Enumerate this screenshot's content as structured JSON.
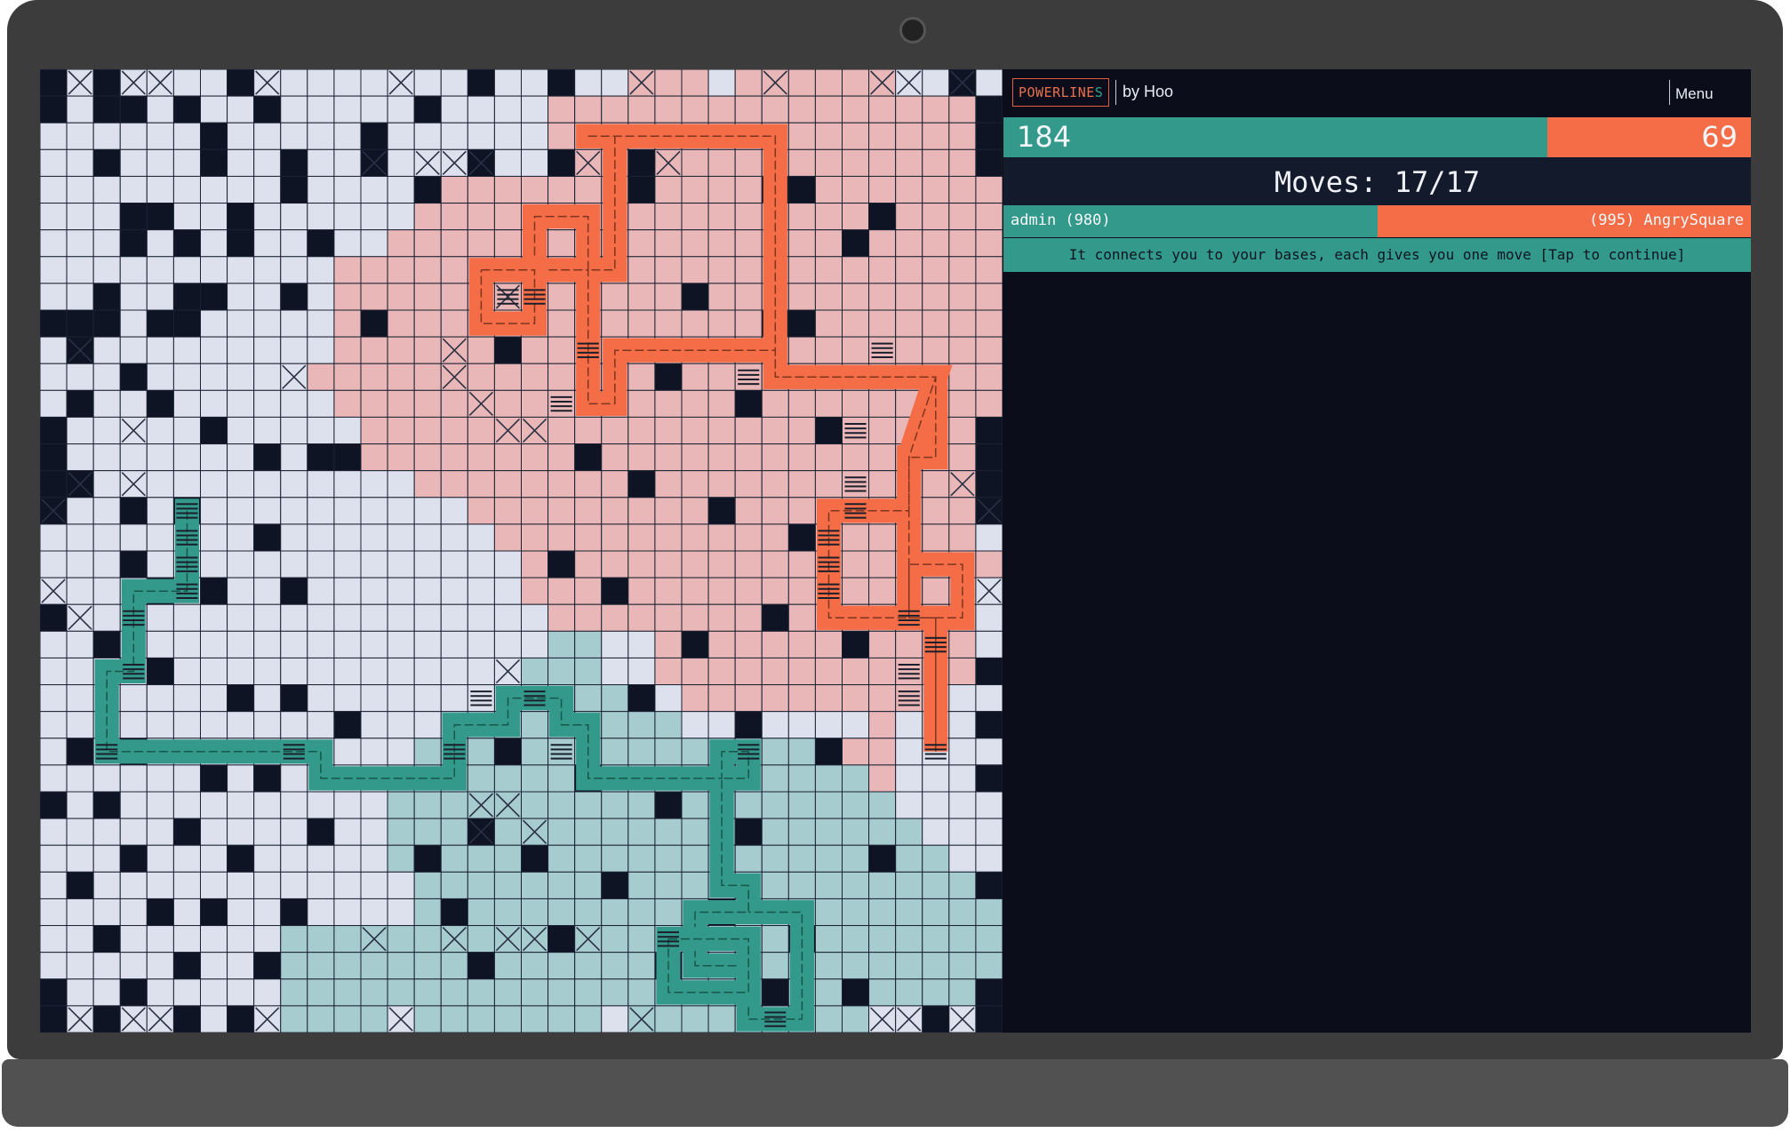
{
  "app": {
    "logo_part1": "POWERLINE",
    "logo_part2": "S",
    "byline": "by Hoo",
    "menu_label": "Menu"
  },
  "score": {
    "green": 184,
    "orange": 69,
    "green_label": "184",
    "orange_label": "69"
  },
  "moves": {
    "text": "Moves: 17/17"
  },
  "players": {
    "left": "admin (980)",
    "right": "(995) AngrySquare",
    "left_share": 0.5
  },
  "message": "It connects you to your bases, each gives you one move [Tap to continue]",
  "colors": {
    "green_team": "#33998a",
    "orange_team": "#f46d46",
    "background": "#0b0e1a",
    "neutral_cell": "#dde1ee",
    "blocked_cell": "#0e1424",
    "orange_territory": "#e9b7b7",
    "green_territory": "#a6ccd0"
  },
  "board": {
    "cols": 36,
    "rows": 36,
    "legend": {
      "N": "neutral cell",
      "B": "blocked cell",
      "O": "orange territory",
      "G": "green territory",
      "o": "orange powerline",
      "g": "green powerline",
      "X": "crossed marker"
    },
    "grid": [
      "BXBXXNNBNXNNNXNNBNNBNXOOOXOOOOOOXXBX",
      "BNBNNBNNNNNNNNBNNNNOOOOOOOOOOOOOOOOB",
      "NNNNNNNNNNNNNNNNNNNOOOOOOOOOOOOOOOOB",
      "NNBNNNBNNBNNBXNXBXXBOOBOOOOOOOOOOOOB",
      "NNNNNNNNNBNNNNBOOOOOOOOOOOOOBOOOOOOO",
      "NNNNBNNNNNNNNNOOOOOOOOOOOOOOOOOBOOOO",
      "NNNBNBNBNNNNNOOOOOOOOOOOOOOOOOOOOOOO",
      "NNNNNNNNNNNOOOOOOOOOOOOOOOOOOOOOOOOO",
      "NNNNNNNNNNNOOOOOOOOOOOOOOOOOOOOOOOOO",
      "BBBNBBNNNNNOOOOOOOOOOOOOOOOBOOOOOOOO",
      "NBNNNNNNNNNOOOOOOOOOOOOOOOOOOOOOOOOO",
      "NXNNNNNNNNOOOOOOOOOOOOOOOOOOOOOOOOOO",
      "NNNNBNNNNNNOOOOOOOOOOOOOOOOOOOOOOOOO",
      "BNNNNNNNNNNNOOOOOOOOOOOOOOOOOOOOOOOB",
      "BNNNNNNNNNNOOOOOOOOOOOOOOOOOOOOOOOOB",
      "BNNNNNNNNNNNNNOOOOOOOOOOOOOOOOOOOOOB",
      "BNNNNNNNNNNNNNNNOOOOOOOOOOOOOOOOOOOB",
      "XNNNNNNNNNNNNNNNNOOOOOOOOOOOOOOOOOOX",
      "NNNNNNNNNNNNNNNNNNOOOOOOOOOOOOOOOOOO",
      "NNNNNNNNNNNNNNNNNNOOOOOOOOOOOOOOOOON",
      "NNNNNNNNNNNNNNNNNNNOOOOOOOOOOOOOOOON",
      "XNNNNNNNNNNNNNNNNNNGGNNOOOOOOOOOOOOX",
      "NNNNNNNNNNNNNNNNNNGGGNNOOOOOOOOOOOOB",
      "NNNNNNNNNNNNNNNNNGGGGGNNOOOOOOOOONNN",
      "NNNNNNNNNNNNNNNGGGGGGGGGNNNNNNNONNNB",
      "NNNNNNNNNNNNNNGGGGGGGGGGGGGGGGOONNNN",
      "NNNNNNNNNNNNNGGGGGGGGGGGGGGGGGGONNNB",
      "NNNNNNNNNNNNNGGGGGGGGGGGGGGGGGGGNNNN",
      "NNNNNNNNNNNNNGGGGGGGGGGGGGGGGGGGGNNN",
      "NNNNNNNNNNNNNGGGGGGGGGGGGGGGGGGGGGNN",
      "NNNNNNNNNNNNNNGGGGGGGGGGGGGGGGGGGGGB",
      "NNNNNNNNNNNNNNGGGGGGGGGGGGGGGGGGGGGG",
      "NNNNNNNNNGGGGGGGGGGGGGGGGGGGGGGGGGGG",
      "NNNNNNNNGGGGGGGGGGGGGGGGGGGGGGGGGGGG",
      "NNNNNNNNNGGGGGGGGGGGGGGGGGGGGGGGGGGB",
      "BXBXXBNBXGGGGXGGGGGGGXGGGGGGGGGXXBXB"
    ],
    "blocked_extra": [
      [
        3,
        1
      ],
      [
        6,
        2
      ],
      [
        8,
        1
      ],
      [
        12,
        2
      ],
      [
        3,
        5
      ],
      [
        7,
        5
      ],
      [
        10,
        6
      ],
      [
        2,
        8
      ],
      [
        5,
        8
      ],
      [
        6,
        8
      ],
      [
        9,
        8
      ],
      [
        12,
        9
      ],
      [
        3,
        11
      ],
      [
        1,
        12
      ],
      [
        4,
        12
      ],
      [
        6,
        13
      ],
      [
        8,
        14
      ],
      [
        10,
        14
      ],
      [
        11,
        14
      ],
      [
        1,
        15
      ],
      [
        3,
        16
      ],
      [
        5,
        16
      ],
      [
        8,
        17
      ],
      [
        3,
        18
      ],
      [
        4,
        19
      ],
      [
        6,
        19
      ],
      [
        9,
        19
      ],
      [
        0,
        20
      ],
      [
        2,
        21
      ],
      [
        4,
        22
      ],
      [
        7,
        23
      ],
      [
        9,
        23
      ],
      [
        11,
        24
      ],
      [
        1,
        25
      ],
      [
        3,
        25
      ],
      [
        6,
        26
      ],
      [
        8,
        26
      ],
      [
        0,
        27
      ],
      [
        2,
        27
      ],
      [
        5,
        28
      ],
      [
        10,
        28
      ],
      [
        3,
        29
      ],
      [
        7,
        29
      ],
      [
        1,
        30
      ],
      [
        4,
        31
      ],
      [
        6,
        31
      ],
      [
        9,
        31
      ],
      [
        2,
        32
      ],
      [
        5,
        33
      ],
      [
        8,
        33
      ],
      [
        0,
        34
      ],
      [
        3,
        34
      ],
      [
        22,
        4
      ],
      [
        27,
        4
      ],
      [
        30,
        6
      ],
      [
        24,
        8
      ],
      [
        28,
        9
      ],
      [
        17,
        10
      ],
      [
        23,
        11
      ],
      [
        26,
        12
      ],
      [
        29,
        13
      ],
      [
        20,
        14
      ],
      [
        22,
        15
      ],
      [
        25,
        16
      ],
      [
        28,
        17
      ],
      [
        19,
        18
      ],
      [
        21,
        19
      ],
      [
        27,
        20
      ],
      [
        30,
        21
      ],
      [
        24,
        21
      ],
      [
        22,
        23
      ],
      [
        26,
        24
      ],
      [
        17,
        25
      ],
      [
        29,
        25
      ],
      [
        20,
        26
      ],
      [
        23,
        27
      ],
      [
        26,
        28
      ],
      [
        18,
        29
      ],
      [
        31,
        29
      ],
      [
        21,
        30
      ],
      [
        25,
        31
      ],
      [
        28,
        32
      ],
      [
        19,
        32
      ],
      [
        23,
        33
      ],
      [
        16,
        33
      ],
      [
        27,
        34
      ],
      [
        30,
        34
      ],
      [
        14,
        29
      ],
      [
        16,
        28
      ],
      [
        15,
        31
      ]
    ],
    "crosses": [
      [
        1,
        0
      ],
      [
        3,
        0
      ],
      [
        4,
        0
      ],
      [
        8,
        0
      ],
      [
        13,
        0
      ],
      [
        22,
        0
      ],
      [
        27,
        0
      ],
      [
        31,
        0
      ],
      [
        32,
        0
      ],
      [
        34,
        0
      ],
      [
        12,
        3
      ],
      [
        14,
        3
      ],
      [
        15,
        3
      ],
      [
        16,
        3
      ],
      [
        20,
        3
      ],
      [
        23,
        3
      ],
      [
        16,
        7
      ],
      [
        19,
        7
      ],
      [
        17,
        8
      ],
      [
        1,
        10
      ],
      [
        15,
        10
      ],
      [
        15,
        11
      ],
      [
        9,
        11
      ],
      [
        16,
        12
      ],
      [
        17,
        13
      ],
      [
        18,
        13
      ],
      [
        3,
        13
      ],
      [
        1,
        15
      ],
      [
        3,
        15
      ],
      [
        0,
        16
      ],
      [
        34,
        15
      ],
      [
        35,
        16
      ],
      [
        0,
        19
      ],
      [
        35,
        19
      ],
      [
        1,
        20
      ],
      [
        17,
        22
      ],
      [
        19,
        23
      ],
      [
        16,
        27
      ],
      [
        17,
        27
      ],
      [
        18,
        28
      ],
      [
        16,
        28
      ],
      [
        12,
        32
      ],
      [
        15,
        32
      ],
      [
        17,
        32
      ],
      [
        18,
        32
      ],
      [
        20,
        32
      ],
      [
        1,
        35
      ],
      [
        3,
        35
      ],
      [
        4,
        35
      ],
      [
        8,
        35
      ],
      [
        13,
        35
      ],
      [
        22,
        35
      ],
      [
        31,
        35
      ],
      [
        32,
        35
      ],
      [
        34,
        35
      ]
    ],
    "orange_path": [
      [
        20,
        2
      ],
      [
        27,
        2
      ],
      [
        27,
        11
      ],
      [
        33,
        11
      ],
      [
        33,
        14
      ],
      [
        32,
        14
      ],
      [
        32,
        20
      ],
      [
        33,
        20
      ],
      [
        33,
        25
      ],
      [
        33,
        20
      ],
      [
        32,
        20
      ],
      [
        32,
        18
      ],
      [
        34,
        18
      ],
      [
        34,
        20
      ],
      [
        29,
        20
      ],
      [
        29,
        16
      ],
      [
        32,
        16
      ],
      [
        32,
        14
      ],
      [
        33,
        11
      ],
      [
        27,
        11
      ],
      [
        27,
        10
      ],
      [
        21,
        10
      ],
      [
        21,
        12
      ],
      [
        20,
        12
      ],
      [
        20,
        7
      ],
      [
        18,
        7
      ],
      [
        18,
        5
      ],
      [
        20,
        5
      ],
      [
        20,
        7
      ],
      [
        21,
        7
      ],
      [
        21,
        2
      ]
    ],
    "orange_loop": [
      [
        16,
        7
      ],
      [
        18,
        7
      ],
      [
        18,
        9
      ],
      [
        16,
        9
      ],
      [
        16,
        7
      ]
    ],
    "green_path": [
      [
        5,
        16
      ],
      [
        5,
        19
      ],
      [
        3,
        19
      ],
      [
        3,
        22
      ],
      [
        2,
        22
      ],
      [
        2,
        25
      ],
      [
        9,
        25
      ],
      [
        10,
        25
      ],
      [
        10,
        26
      ],
      [
        15,
        26
      ],
      [
        15,
        24
      ],
      [
        17,
        24
      ],
      [
        17,
        23
      ],
      [
        19,
        23
      ],
      [
        19,
        24
      ],
      [
        20,
        24
      ],
      [
        20,
        26
      ],
      [
        25,
        26
      ],
      [
        25,
        25
      ],
      [
        26,
        25
      ],
      [
        26,
        26
      ],
      [
        25,
        26
      ],
      [
        25,
        30
      ],
      [
        26,
        30
      ],
      [
        26,
        31
      ],
      [
        24,
        31
      ],
      [
        24,
        33
      ],
      [
        26,
        33
      ],
      [
        26,
        35
      ],
      [
        28,
        35
      ],
      [
        28,
        31
      ],
      [
        26,
        31
      ]
    ],
    "green_loop": [
      [
        23,
        32
      ],
      [
        26,
        32
      ],
      [
        26,
        34
      ],
      [
        23,
        34
      ],
      [
        23,
        32
      ]
    ],
    "orange_bases": [
      [
        17,
        8
      ],
      [
        18,
        8
      ],
      [
        20,
        10
      ],
      [
        19,
        12
      ],
      [
        31,
        10
      ],
      [
        30,
        13
      ],
      [
        30,
        15
      ],
      [
        30,
        16
      ],
      [
        29,
        17
      ],
      [
        29,
        18
      ],
      [
        29,
        19
      ],
      [
        32,
        20
      ],
      [
        33,
        21
      ],
      [
        32,
        22
      ],
      [
        32,
        23
      ],
      [
        33,
        25
      ],
      [
        26,
        11
      ]
    ],
    "green_bases": [
      [
        5,
        16
      ],
      [
        5,
        17
      ],
      [
        5,
        18
      ],
      [
        5,
        19
      ],
      [
        3,
        20
      ],
      [
        3,
        22
      ],
      [
        2,
        25
      ],
      [
        9,
        25
      ],
      [
        15,
        25
      ],
      [
        16,
        23
      ],
      [
        18,
        23
      ],
      [
        19,
        25
      ],
      [
        26,
        25
      ],
      [
        23,
        32
      ],
      [
        27,
        35
      ]
    ]
  }
}
